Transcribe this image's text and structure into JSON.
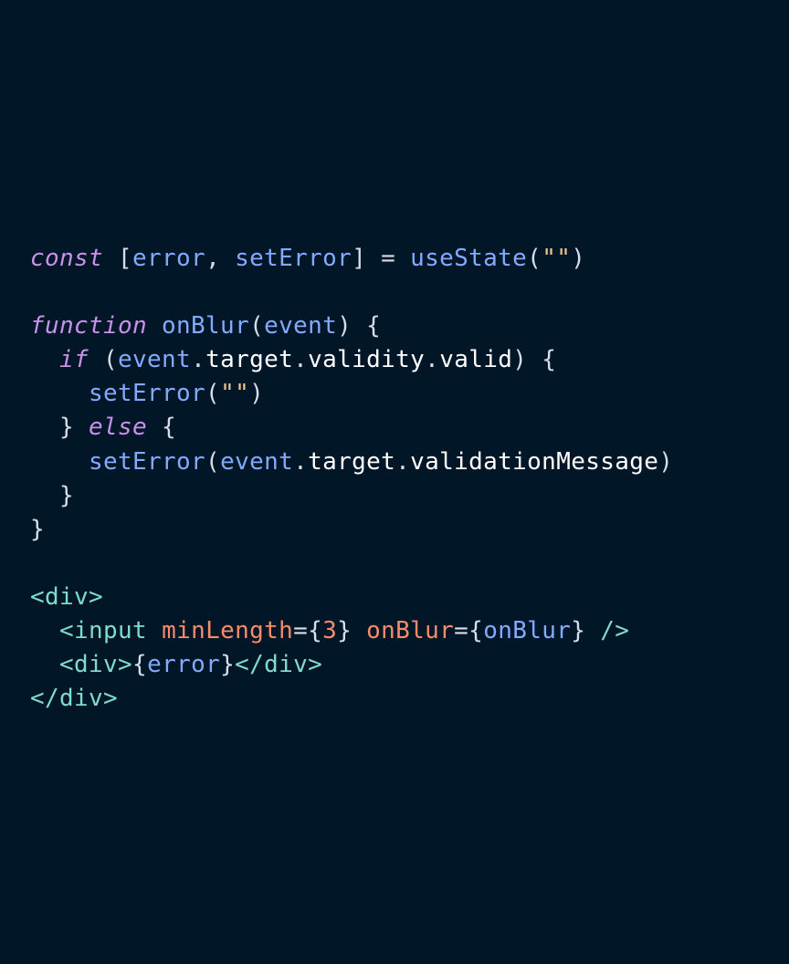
{
  "theme": {
    "background": "#011627",
    "default_text": "#d6deeb",
    "keyword": "#c792ea",
    "identifier": "#82aaff",
    "property": "#ffffff",
    "string": "#ecc48d",
    "jsx_tag": "#7fdbca",
    "jsx_attribute": "#f78c6c"
  },
  "code": {
    "lines": [
      [
        {
          "text": "const",
          "type": "kw"
        },
        {
          "text": " [",
          "type": "punct"
        },
        {
          "text": "error",
          "type": "var"
        },
        {
          "text": ", ",
          "type": "punct"
        },
        {
          "text": "setError",
          "type": "var"
        },
        {
          "text": "] = ",
          "type": "punct"
        },
        {
          "text": "useState",
          "type": "fn"
        },
        {
          "text": "(",
          "type": "punct"
        },
        {
          "text": "\"\"",
          "type": "str"
        },
        {
          "text": ")",
          "type": "punct"
        }
      ],
      [],
      [
        {
          "text": "function",
          "type": "kw"
        },
        {
          "text": " ",
          "type": "punct"
        },
        {
          "text": "onBlur",
          "type": "fn"
        },
        {
          "text": "(",
          "type": "punct"
        },
        {
          "text": "event",
          "type": "var"
        },
        {
          "text": ") {",
          "type": "punct"
        }
      ],
      [
        {
          "text": "  ",
          "type": "punct"
        },
        {
          "text": "if",
          "type": "kw"
        },
        {
          "text": " (",
          "type": "punct"
        },
        {
          "text": "event",
          "type": "var"
        },
        {
          "text": ".",
          "type": "punct"
        },
        {
          "text": "target",
          "type": "prop"
        },
        {
          "text": ".",
          "type": "punct"
        },
        {
          "text": "validity",
          "type": "prop"
        },
        {
          "text": ".",
          "type": "punct"
        },
        {
          "text": "valid",
          "type": "prop"
        },
        {
          "text": ") {",
          "type": "punct"
        }
      ],
      [
        {
          "text": "    ",
          "type": "punct"
        },
        {
          "text": "setError",
          "type": "fn"
        },
        {
          "text": "(",
          "type": "punct"
        },
        {
          "text": "\"\"",
          "type": "str"
        },
        {
          "text": ")",
          "type": "punct"
        }
      ],
      [
        {
          "text": "  } ",
          "type": "punct"
        },
        {
          "text": "else",
          "type": "kw"
        },
        {
          "text": " {",
          "type": "punct"
        }
      ],
      [
        {
          "text": "    ",
          "type": "punct"
        },
        {
          "text": "setError",
          "type": "fn"
        },
        {
          "text": "(",
          "type": "punct"
        },
        {
          "text": "event",
          "type": "var"
        },
        {
          "text": ".",
          "type": "punct"
        },
        {
          "text": "target",
          "type": "prop"
        },
        {
          "text": ".",
          "type": "punct"
        },
        {
          "text": "validationMessage",
          "type": "prop"
        },
        {
          "text": ")",
          "type": "punct"
        }
      ],
      [
        {
          "text": "  }",
          "type": "punct"
        }
      ],
      [
        {
          "text": "}",
          "type": "punct"
        }
      ],
      [],
      [
        {
          "text": "<div>",
          "type": "tag"
        }
      ],
      [
        {
          "text": "  ",
          "type": "punct"
        },
        {
          "text": "<input",
          "type": "tag"
        },
        {
          "text": " ",
          "type": "punct"
        },
        {
          "text": "minLength",
          "type": "attr"
        },
        {
          "text": "={",
          "type": "punct"
        },
        {
          "text": "3",
          "type": "num"
        },
        {
          "text": "} ",
          "type": "punct"
        },
        {
          "text": "onBlur",
          "type": "attr"
        },
        {
          "text": "={",
          "type": "punct"
        },
        {
          "text": "onBlur",
          "type": "var"
        },
        {
          "text": "} ",
          "type": "punct"
        },
        {
          "text": "/>",
          "type": "tag"
        }
      ],
      [
        {
          "text": "  ",
          "type": "punct"
        },
        {
          "text": "<div>",
          "type": "tag"
        },
        {
          "text": "{",
          "type": "punct"
        },
        {
          "text": "error",
          "type": "var"
        },
        {
          "text": "}",
          "type": "punct"
        },
        {
          "text": "</div>",
          "type": "tag"
        }
      ],
      [
        {
          "text": "</div>",
          "type": "tag"
        }
      ]
    ]
  }
}
